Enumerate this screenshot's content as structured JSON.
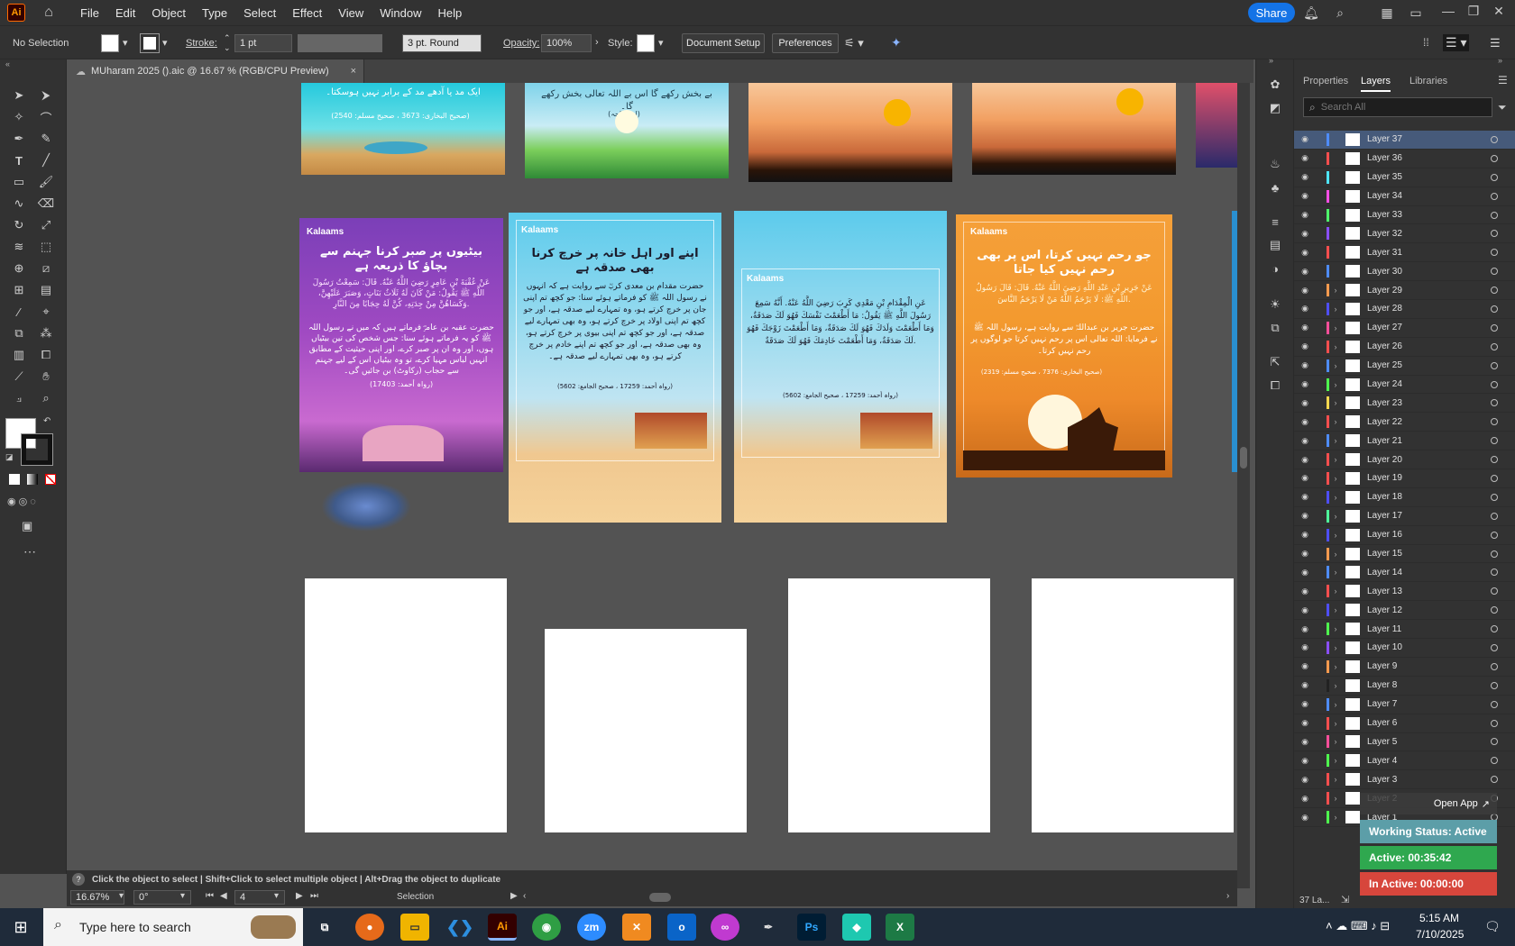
{
  "app": {
    "logo": "Ai",
    "home_icon": "home-icon"
  },
  "menu": [
    "File",
    "Edit",
    "Object",
    "Type",
    "Select",
    "Effect",
    "View",
    "Window",
    "Help"
  ],
  "topright": {
    "share": "Share"
  },
  "control": {
    "selection": "No Selection",
    "stroke_label": "Stroke:",
    "stroke_value": "1 pt",
    "brush": "3 pt. Round",
    "opacity_label": "Opacity:",
    "opacity_value": "100%",
    "style_label": "Style:",
    "document_setup": "Document Setup",
    "preferences": "Preferences"
  },
  "document_tab": {
    "title": "MUharam 2025 ().aic @ 16.67 % (RGB/CPU Preview)",
    "close": "×"
  },
  "artboards": {
    "brand": "Kalaams",
    "a1_title": "بیٹیوں پر صبر کرنا جہنم سے بچاؤ کا ذریعہ ہے",
    "a1_arabic": "عَنْ عُقْبَةَ بْنِ عَامِرٍ رَضِيَ اللَّهُ عَنْهُ. قَالَ: سَمِعْتُ رَسُولَ اللَّهِ ﷺ يَقُولُ: مَنْ كَانَ لَهُ ثَلَاثُ بَنَاتٍ، وَصَبَرَ عَلَيْهِنَّ، وَكَسَاهُنَّ مِنْ جِدَتِهِ، كُنَّ لَهُ حِجَابًا مِنَ النَّارِ.",
    "a1_urdu": "حضرت عقبہ بن عامرؓ فرماتے ہیں کہ میں نے رسول اللہ ﷺ کو یہ فرماتے ہوئے سنا: جس شخص کی تین بیٹیاں ہوں، اور وہ ان پر صبر کرے، اور اپنی حیثیت کے مطابق انہیں لباس مہیا کرے، تو وہ بیٹیاں اس کے لیے جہنم سے حجاب (رکاوٹ) بن جائیں گی۔",
    "a1_ref": "(رواہ أحمد: 17403)",
    "a2_title": "اپنے اور اہل خانہ پر خرچ کرنا بھی صدقہ ہے",
    "a2_urdu": "حضرت مقدام بن معدی کربؓ سے روایت ہے کہ انہوں نے رسول اللہ ﷺ کو فرماتے ہوئے سنا: جو کچھ تم اپنی جان پر خرچ کرتے ہو، وہ تمہارے لیے صدقہ ہے، اور جو کچھ تم اپنی اولاد پر خرچ کرتے ہو، وہ بھی تمہارے لیے صدقہ ہے، اور جو کچھ تم اپنی بیوی پر خرچ کرتے ہو، وہ بھی صدقہ ہے، اور جو کچھ تم اپنے خادم پر خرچ کرتے ہو، وہ بھی تمہارے لیے صدقہ ہے۔",
    "a2_ref": "(رواہ أحمد: 17259 ، صحیح الجامع: 5602)",
    "a3_arabic": "عَنِ الْمِقْدَامِ بْنِ مَعْدِي كَرِبَ رَضِيَ اللَّهُ عَنْهُ. أَنَّهُ سَمِعَ رَسُولَ اللَّهِ ﷺ يَقُولُ: مَا أَطْعَمْتَ نَفْسَكَ فَهُوَ لَكَ صَدَقَةٌ، وَمَا أَطْعَمْتَ وَلَدَكَ فَهُوَ لَكَ صَدَقَةٌ، وَمَا أَطْعَمْتَ زَوْجَكَ فَهُوَ لَكَ صَدَقَةٌ، وَمَا أَطْعَمْتَ خَادِمَكَ فَهُوَ لَكَ صَدَقَةٌ.",
    "a3_ref": "(رواہ أحمد: 17259 ، صحیح الجامع: 5602)",
    "a4_title": "جو رحم نہیں کرتا، اس پر بھی رحم نہیں کیا جاتا",
    "a4_arabic": "عَنْ جَرِيرِ بْنِ عَبْدِ اللَّهِ رَضِيَ اللَّهُ عَنْهُ. قَالَ: قَالَ رَسُولُ اللَّهِ ﷺ: لَا يَرْحَمُ اللَّهُ مَنْ لَا يَرْحَمُ النَّاسَ.",
    "a4_urdu": "حضرت جریر بن عبداللہؓ سے روایت ہے، رسول اللہ ﷺ نے فرمایا: اللہ تعالی اس پر رحم نہیں کرتا جو لوگوں پر رحم نہیں کرتا۔",
    "a4_ref": "(صحیح البخاری: 7376 ، صحیح مسلم: 2319)",
    "top1_text": "ایک مد یا آدھے مد کے برابر نہیں ہوسکتا۔",
    "top1_ref": "(صحیح البخاری: 3673 ، صحیح مسلم: 2540)",
    "top2_text": "بے بخش رکھے گا اس بے اللہ تعالی بخش رکھے گا۔",
    "top2_ref": "(ابن ماجہ)"
  },
  "status": {
    "hint": "Click the object to select  |  Shift+Click to select multiple object  |  Alt+Drag the object to duplicate",
    "zoom": "16.67%",
    "angle": "0°",
    "artboard_num": "4",
    "tool": "Selection"
  },
  "panel": {
    "tabs": [
      "Properties",
      "Layers",
      "Libraries"
    ],
    "search_placeholder": "Search All",
    "layers": [
      "Layer 37",
      "Layer 36",
      "Layer 35",
      "Layer 34",
      "Layer 33",
      "Layer 32",
      "Layer 31",
      "Layer 30",
      "Layer 29",
      "Layer 28",
      "Layer 27",
      "Layer 26",
      "Layer 25",
      "Layer 24",
      "Layer 23",
      "Layer 22",
      "Layer 21",
      "Layer 20",
      "Layer 19",
      "Layer 18",
      "Layer 17",
      "Layer 16",
      "Layer 15",
      "Layer 14",
      "Layer 13",
      "Layer 12",
      "Layer 11",
      "Layer 10",
      "Layer 9",
      "Layer 8",
      "Layer 7",
      "Layer 6",
      "Layer 5",
      "Layer 4",
      "Layer 3",
      "Layer 2",
      "Layer 1"
    ],
    "layer_colors": [
      "#4e8cff",
      "#ff4e4e",
      "#4ee6ff",
      "#ff4ee6",
      "#4eff6a",
      "#8a4eff",
      "#ff4e4e",
      "#4e8cff",
      "#ff9a4e",
      "#4e4eff",
      "#ff4e9a",
      "#ff4e4e",
      "#4e8cff",
      "#4eff4e",
      "#ffd84e",
      "#ff4e4e",
      "#4e8cff",
      "#ff4e4e",
      "#ff4e4e",
      "#4e4eff",
      "#4eff9a",
      "#4e4eff",
      "#ff9a4e",
      "#4e8cff",
      "#ff4e4e",
      "#4e4eff",
      "#4eff4e",
      "#8a4eff",
      "#ff9a4e",
      "#222222",
      "#4e8cff",
      "#ff4e4e",
      "#ff4e9a",
      "#4eff4e",
      "#ff4e4e",
      "#ff4e4e",
      "#4eff4e"
    ],
    "count": "37 La..."
  },
  "overlay": {
    "open_app": "Open App",
    "working": "Working Status: Active",
    "active": "Active: 00:35:42",
    "inactive": "In Active: 00:00:00"
  },
  "taskbar": {
    "search": "Type here to search",
    "time": "5:15 AM",
    "date": "7/10/2025"
  }
}
